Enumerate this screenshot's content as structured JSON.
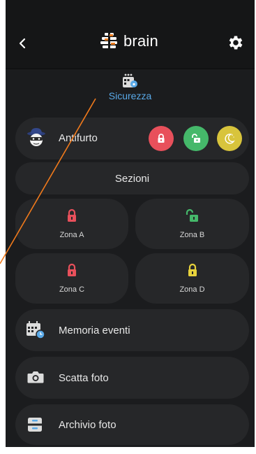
{
  "header": {
    "logo_text": "brain",
    "back_icon": "chevron-left-icon",
    "settings_icon": "gear-icon"
  },
  "section": {
    "title": "Sicurezza",
    "icon": "security-panel-icon"
  },
  "antifurto": {
    "label": "Antifurto",
    "icon": "burglar-icon",
    "modes": [
      {
        "name": "locked",
        "color": "#e8505b",
        "icon": "lock-closed-icon"
      },
      {
        "name": "unlocked",
        "color": "#45b86a",
        "icon": "lock-open-icon"
      },
      {
        "name": "night",
        "color": "#d8c43c",
        "icon": "moon-icon"
      }
    ]
  },
  "sezioni": {
    "label": "Sezioni"
  },
  "zones": [
    {
      "label": "Zona A",
      "state": "locked",
      "color": "#e8505b"
    },
    {
      "label": "Zona B",
      "state": "unlocked",
      "color": "#45b86a"
    },
    {
      "label": "Zona C",
      "state": "locked",
      "color": "#e8505b"
    },
    {
      "label": "Zona D",
      "state": "locked",
      "color": "#e7d23c"
    }
  ],
  "menu": [
    {
      "label": "Memoria eventi",
      "icon": "calendar-clock-icon"
    },
    {
      "label": "Scatta foto",
      "icon": "camera-icon"
    },
    {
      "label": "Archivio foto",
      "icon": "archive-icon"
    }
  ],
  "colors": {
    "background": "#1b1c1e",
    "card": "#262729",
    "accent": "#59a9e8",
    "annotation": "#f07a1c"
  }
}
